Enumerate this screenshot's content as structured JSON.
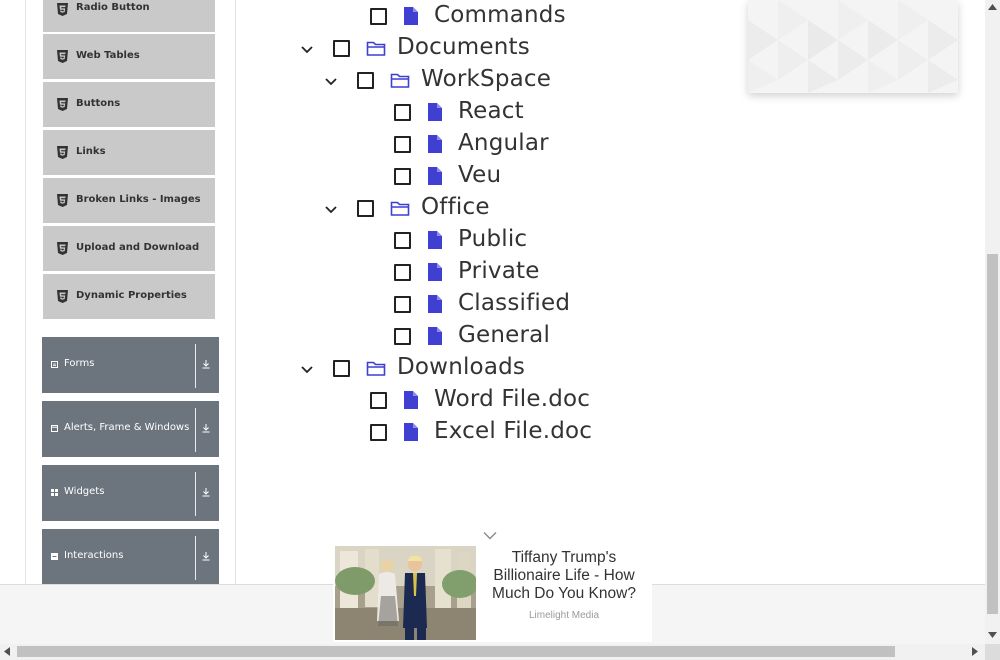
{
  "sidebar": {
    "element_items": [
      {
        "label": "Radio Button",
        "icon": "html5-icon"
      },
      {
        "label": "Web Tables",
        "icon": "html5-icon"
      },
      {
        "label": "Buttons",
        "icon": "html5-icon"
      },
      {
        "label": "Links",
        "icon": "html5-icon"
      },
      {
        "label": "Broken Links - Images",
        "icon": "html5-icon"
      },
      {
        "label": "Upload and Download",
        "icon": "html5-icon"
      },
      {
        "label": "Dynamic Properties",
        "icon": "html5-icon"
      }
    ],
    "groups": [
      {
        "label": "Forms",
        "icon": "file-icon"
      },
      {
        "label": "Alerts, Frame & Windows",
        "icon": "window-icon"
      },
      {
        "label": "Widgets",
        "icon": "grid-icon"
      },
      {
        "label": "Interactions",
        "icon": "list-icon"
      }
    ]
  },
  "tree": {
    "nodes": [
      {
        "label": "Commands",
        "type": "file",
        "expanded": null,
        "checked": false
      },
      {
        "label": "Documents",
        "type": "folder",
        "expanded": true,
        "checked": false
      },
      {
        "label": "WorkSpace",
        "type": "folder",
        "expanded": true,
        "checked": false
      },
      {
        "label": "React",
        "type": "file",
        "expanded": null,
        "checked": false
      },
      {
        "label": "Angular",
        "type": "file",
        "expanded": null,
        "checked": false
      },
      {
        "label": "Veu",
        "type": "file",
        "expanded": null,
        "checked": false
      },
      {
        "label": "Office",
        "type": "folder",
        "expanded": true,
        "checked": false
      },
      {
        "label": "Public",
        "type": "file",
        "expanded": null,
        "checked": false
      },
      {
        "label": "Private",
        "type": "file",
        "expanded": null,
        "checked": false
      },
      {
        "label": "Classified",
        "type": "file",
        "expanded": null,
        "checked": false
      },
      {
        "label": "General",
        "type": "file",
        "expanded": null,
        "checked": false
      },
      {
        "label": "Downloads",
        "type": "folder",
        "expanded": true,
        "checked": false
      },
      {
        "label": "Word File.doc",
        "type": "file",
        "expanded": null,
        "checked": false
      },
      {
        "label": "Excel File.doc",
        "type": "file",
        "expanded": null,
        "checked": false
      }
    ]
  },
  "ad": {
    "headline": "Tiffany Trump's Billionaire Life - How Much Do You Know?",
    "source": "Limelight Media"
  },
  "colors": {
    "tree_icon": "#3f3fd1",
    "group_bg": "#6c757d",
    "submenu_bg": "#c9c9c9"
  }
}
